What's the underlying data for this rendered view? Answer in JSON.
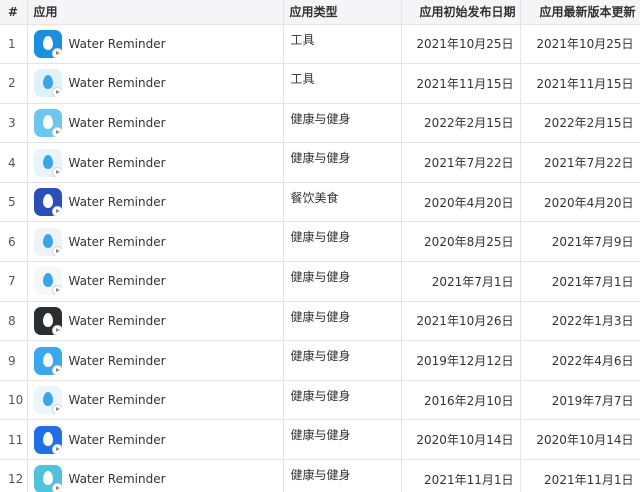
{
  "headers": {
    "num": "#",
    "app": "应用",
    "type": "应用类型",
    "initial_date": "应用初始发布日期",
    "latest_date": "应用最新版本更新"
  },
  "rows": [
    {
      "num": "1",
      "name": "Water Reminder",
      "type": "工具",
      "initial": "2021年10月25日",
      "latest": "2021年10月25日",
      "icon": "water-drop-c-icon",
      "color": "#1a8fe0"
    },
    {
      "num": "2",
      "name": "Water Reminder",
      "type": "工具",
      "initial": "2021年11月15日",
      "latest": "2021年11月15日",
      "icon": "water-glass-icon",
      "color": "#dff1fb"
    },
    {
      "num": "3",
      "name": "Water Reminder",
      "type": "健康与健身",
      "initial": "2022年2月15日",
      "latest": "2022年2月15日",
      "icon": "water-drop-icon",
      "color": "#6cc6ef"
    },
    {
      "num": "4",
      "name": "Water Reminder",
      "type": "健康与健身",
      "initial": "2021年7月22日",
      "latest": "2021年7月22日",
      "icon": "water-drops-icon",
      "color": "#e8f4fb"
    },
    {
      "num": "5",
      "name": "Water Reminder",
      "type": "餐饮美食",
      "initial": "2020年4月20日",
      "latest": "2020年4月20日",
      "icon": "water-reminder-text-icon",
      "color": "#2a4fb8"
    },
    {
      "num": "6",
      "name": "Water Reminder",
      "type": "健康与健身",
      "initial": "2020年8月25日",
      "latest": "2021年7月9日",
      "icon": "person-drinking-icon",
      "color": "#eef3f7"
    },
    {
      "num": "7",
      "name": "Water Reminder",
      "type": "健康与健身",
      "initial": "2021年7月1日",
      "latest": "2021年7月1日",
      "icon": "water-drop-icon",
      "color": "#f4f8fb"
    },
    {
      "num": "8",
      "name": "Water Reminder",
      "type": "健康与健身",
      "initial": "2021年10月26日",
      "latest": "2022年1月3日",
      "icon": "cloud-drop-icon",
      "color": "#2b2d30"
    },
    {
      "num": "9",
      "name": "Water Reminder",
      "type": "健康与健身",
      "initial": "2019年12月12日",
      "latest": "2022年4月6日",
      "icon": "water-drop-icon",
      "color": "#3aa8ee"
    },
    {
      "num": "10",
      "name": "Water Reminder",
      "type": "健康与健身",
      "initial": "2016年2月10日",
      "latest": "2019年7月7日",
      "icon": "water-glass-icon",
      "color": "#e9f6fc"
    },
    {
      "num": "11",
      "name": "Water Reminder",
      "type": "健康与健身",
      "initial": "2020年10月14日",
      "latest": "2020年10月14日",
      "icon": "water-drop-icon",
      "color": "#1f6fe6"
    },
    {
      "num": "12",
      "name": "Water Reminder",
      "type": "健康与健身",
      "initial": "2021年11月1日",
      "latest": "2021年11月1日",
      "icon": "water-wave-icon",
      "color": "#4fc3d9"
    }
  ]
}
